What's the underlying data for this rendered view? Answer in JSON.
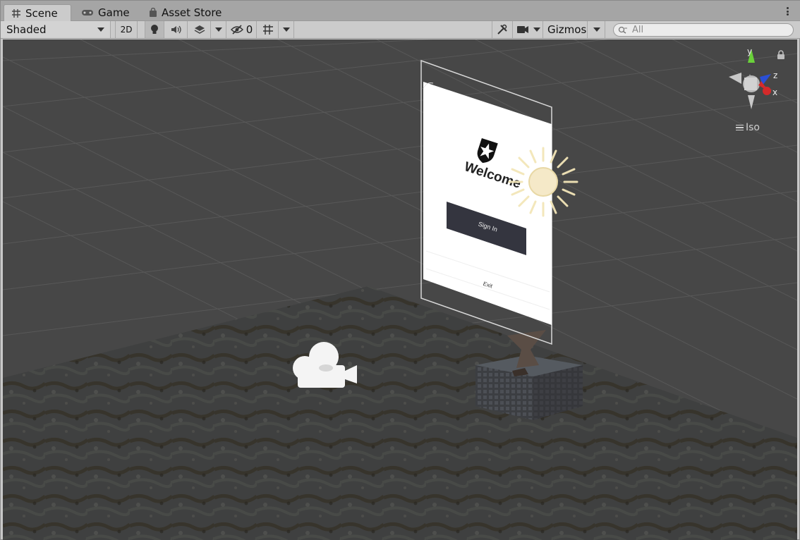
{
  "tabs": [
    {
      "label": "Scene",
      "icon": "grid-icon",
      "active": true
    },
    {
      "label": "Game",
      "icon": "gamepad-icon",
      "active": false
    },
    {
      "label": "Asset Store",
      "icon": "shopping-bag-icon",
      "active": false
    }
  ],
  "toolbar": {
    "shading_mode": "Shaded",
    "toggle_2d": "2D",
    "hidden_count": "0",
    "gizmos": "Gizmos",
    "search_placeholder": "All"
  },
  "scene": {
    "ui_panel": {
      "title": "Welcome",
      "sign_in_button": "Sign In",
      "exit_button": "Exit"
    }
  },
  "orientation_gizmo": {
    "axis_y": "y",
    "axis_z": "z",
    "axis_x": "x",
    "projection": "Iso"
  },
  "colors": {
    "x_axis": "#d42a2a",
    "y_axis": "#6ad13a",
    "z_axis": "#2a4fd6",
    "viewport_bg": "#474747",
    "sign_in_button_bg": "#3a3a4a"
  }
}
